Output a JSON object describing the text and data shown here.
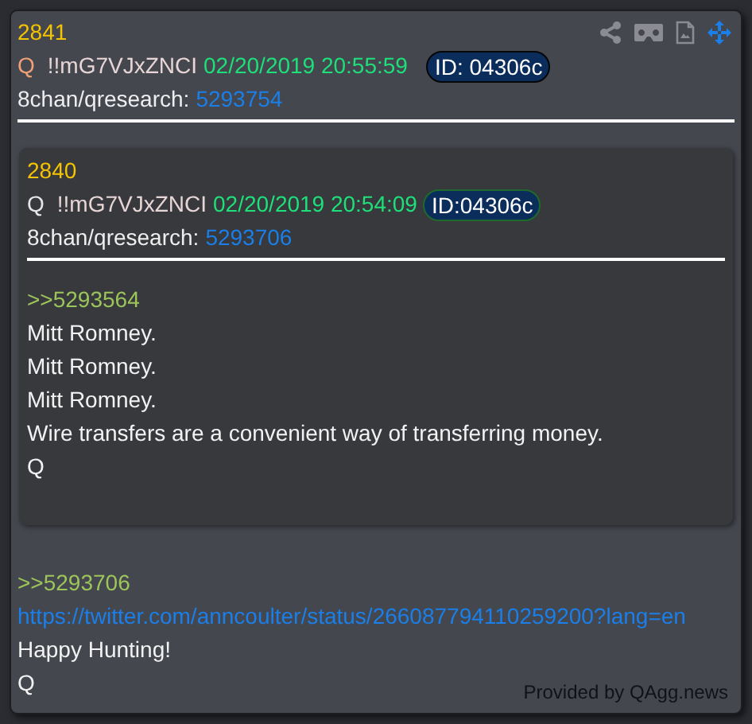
{
  "post": {
    "number": "2841",
    "author_mark": "Q",
    "tripcode": "!!mG7VJxZNCI",
    "timestamp": "02/20/2019 20:55:59",
    "id_badge": "ID: 04306c",
    "board": "8chan/qresearch:",
    "post_link": "5293754",
    "quoted_post": {
      "number": "2840",
      "author_mark": "Q",
      "tripcode": "!!mG7VJxZNCI",
      "timestamp": "02/20/2019 20:54:09",
      "id_badge": "ID:04306c",
      "board": "8chan/qresearch:",
      "post_link": "5293706",
      "lines": [
        {
          "kind": "reply_ref",
          "text": ">>5293564"
        },
        {
          "kind": "text",
          "text": "Mitt Romney."
        },
        {
          "kind": "text",
          "text": "Mitt Romney."
        },
        {
          "kind": "text",
          "text": "Mitt Romney."
        },
        {
          "kind": "text",
          "text": "Wire transfers are a convenient way of transferring money."
        },
        {
          "kind": "text",
          "text": "Q"
        }
      ]
    },
    "lines": [
      {
        "kind": "reply_ref",
        "text": ">>5293706"
      },
      {
        "kind": "link",
        "text": "https://twitter.com/anncoulter/status/266087794110259200?lang=en"
      },
      {
        "kind": "text",
        "text": "Happy Hunting!"
      },
      {
        "kind": "text",
        "text": "Q"
      }
    ]
  },
  "footer": "Provided by QAgg.news"
}
